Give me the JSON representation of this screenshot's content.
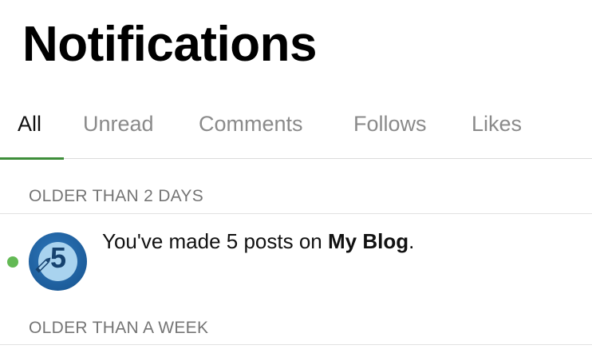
{
  "header": {
    "title": "Notifications"
  },
  "tabs": [
    {
      "label": "All",
      "active": true
    },
    {
      "label": "Unread",
      "active": false
    },
    {
      "label": "Comments",
      "active": false
    },
    {
      "label": "Follows",
      "active": false
    },
    {
      "label": "Likes",
      "active": false
    }
  ],
  "colors": {
    "accent": "#3e8e3a",
    "unread_dot": "#63b955",
    "avatar_blue": "#1d5d9b"
  },
  "sections": [
    {
      "header": "OLDER THAN 2 DAYS",
      "notifications": [
        {
          "text_prefix": "You've made 5 posts on ",
          "site_name": "My Blog",
          "text_suffix": ".",
          "badge_number": "5",
          "icon": "pencil-icon",
          "unread": true
        }
      ]
    },
    {
      "header": "OLDER THAN A WEEK",
      "notifications": []
    }
  ]
}
